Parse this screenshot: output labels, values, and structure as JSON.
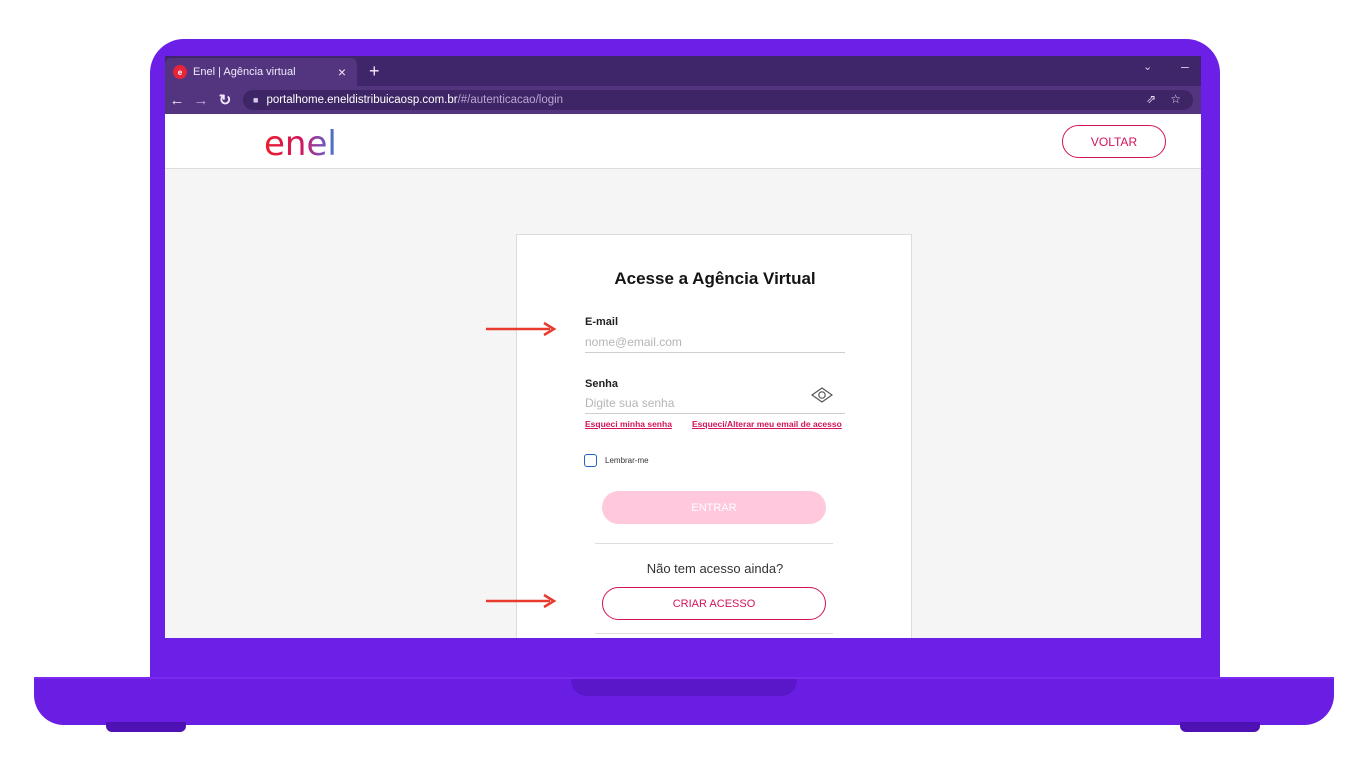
{
  "colors": {
    "laptop": "#6c1fe6",
    "browser_frame": "#52357e",
    "brand_pink": "#d3135a",
    "annotation_arrow": "#e83a2e"
  },
  "browser": {
    "tab_title": "Enel | Agência virtual",
    "tab_close_icon": "×",
    "new_tab_icon": "+",
    "url_host": "portalhome.eneldistribuicaosp.com.br",
    "url_path": "/#/autenticacao/login"
  },
  "header": {
    "logo_text": "enel",
    "back_button": "VOLTAR"
  },
  "login": {
    "title": "Acesse a Agência Virtual",
    "email_label": "E-mail",
    "email_placeholder": "nome@email.com",
    "password_label": "Senha",
    "password_placeholder": "Digite sua senha",
    "forgot_password": "Esqueci minha senha",
    "forgot_email": "Esqueci/Alterar meu email de acesso",
    "remember_me": "Lembrar-me",
    "submit_button": "ENTRAR",
    "no_access_text": "Não tem acesso ainda?",
    "create_access_button": "CRIAR ACESSO"
  },
  "icons": {
    "favicon": "enel-favicon-icon",
    "lock": "lock-icon",
    "eye": "eye-icon",
    "share": "share-icon",
    "star": "bookmark-star-icon"
  }
}
